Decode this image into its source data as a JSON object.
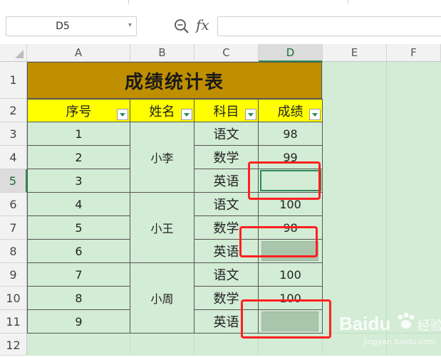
{
  "name_box": {
    "value": "D5"
  },
  "formula_bar": {
    "fx_label": "fx",
    "value": ""
  },
  "columns": [
    "A",
    "B",
    "C",
    "D",
    "E",
    "F"
  ],
  "rows": [
    "1",
    "2",
    "3",
    "4",
    "5",
    "6",
    "7",
    "8",
    "9",
    "10",
    "11",
    "12"
  ],
  "selected_cell": {
    "column": "D",
    "row": "5"
  },
  "sheet": {
    "title": "成绩统计表",
    "headers": [
      "序号",
      "姓名",
      "科目",
      "成绩"
    ],
    "seq": [
      "1",
      "2",
      "3",
      "4",
      "5",
      "6",
      "7",
      "8",
      "9"
    ],
    "names": [
      "小李",
      "小王",
      "小周"
    ],
    "subjects": [
      "语文",
      "数学",
      "英语",
      "语文",
      "数学",
      "英语",
      "语文",
      "数学",
      "英语"
    ],
    "scores": [
      "98",
      "99",
      "",
      "100",
      "98",
      "",
      "100",
      "100",
      ""
    ]
  },
  "watermark": {
    "brand": "Baidu",
    "cn": "经验",
    "url": "jingyan.baidu.com"
  },
  "colors": {
    "title_fill": "#bf8f00",
    "header_fill": "#ffff00",
    "sheet_bg": "#d3ecd5",
    "highlight_fill": "#a9c6ad",
    "annotation": "#ff2020",
    "selection": "#2e8b57"
  },
  "icons": [
    "zoom-search-icon",
    "filter-dropdown-icon",
    "dropdown-caret-icon",
    "select-all-icon"
  ]
}
